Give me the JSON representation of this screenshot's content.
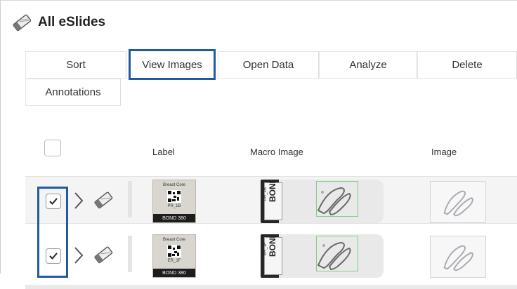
{
  "page": {
    "title": "All eSlides",
    "title_icon": "slide-icon"
  },
  "toolbar": {
    "buttons": [
      {
        "label": "Sort",
        "highlighted": false
      },
      {
        "label": "View Images",
        "highlighted": true
      },
      {
        "label": "Open Data",
        "highlighted": false
      },
      {
        "label": "Analyze",
        "highlighted": false
      },
      {
        "label": "Delete",
        "highlighted": false
      },
      {
        "label": "Annotations",
        "highlighted": false
      }
    ]
  },
  "table": {
    "header_checked": false,
    "columns": {
      "label": "Label",
      "macro": "Macro Image",
      "image": "Image"
    },
    "rows": [
      {
        "checked": true,
        "label_thumb": {
          "line1": "Breast Core",
          "line2": "PR_1B",
          "strip": "BOND 380"
        },
        "macro_thumb": {
          "text": "BOND 380",
          "code": "PR_1B"
        }
      },
      {
        "checked": true,
        "label_thumb": {
          "line1": "Breast Core",
          "line2": "ER_1F",
          "strip": "BOND 380"
        },
        "macro_thumb": {
          "text": "BOND 380",
          "code": "ER_1F"
        }
      }
    ]
  },
  "colors": {
    "highlight": "#1f5aa3",
    "roi": "#7fcf7f"
  }
}
